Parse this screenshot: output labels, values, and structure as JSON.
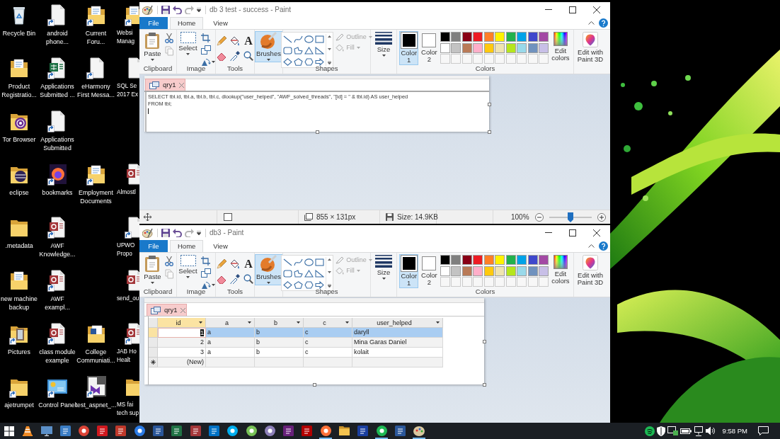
{
  "desktop_rows": [
    {
      "icons": [
        {
          "kind": "recycle-bin",
          "shortcut": false,
          "covered": false,
          "label": "Recycle Bin"
        },
        {
          "kind": "document",
          "shortcut": true,
          "covered": false,
          "label": "android\nphone..."
        },
        {
          "kind": "folder-docs",
          "shortcut": true,
          "covered": false,
          "label": "Current\nForu..."
        },
        {
          "kind": "folder-docs",
          "shortcut": true,
          "covered": true,
          "label": "Websi\nManag"
        }
      ]
    },
    {
      "icons": [
        {
          "kind": "folder-docs",
          "shortcut": false,
          "covered": false,
          "label": "Product\nRegistratio..."
        },
        {
          "kind": "spreadsheet",
          "shortcut": true,
          "covered": false,
          "label": "Applications\nSubmitted ..."
        },
        {
          "kind": "document",
          "shortcut": true,
          "covered": false,
          "label": "eHarmony\nFirst Messa..."
        },
        {
          "kind": "document",
          "shortcut": false,
          "covered": true,
          "label": "SQL Se\n2017 Ex"
        }
      ]
    },
    {
      "icons": [
        {
          "kind": "tor",
          "shortcut": false,
          "covered": false,
          "label": "Tor Browser"
        },
        {
          "kind": "document",
          "shortcut": true,
          "covered": false,
          "label": "Applications\nSubmitted"
        }
      ]
    },
    {
      "icons": [
        {
          "kind": "eclipse",
          "shortcut": false,
          "covered": false,
          "label": "eclipse"
        },
        {
          "kind": "browser",
          "shortcut": true,
          "covered": false,
          "label": "bookmarks"
        },
        {
          "kind": "folder-docs",
          "shortcut": true,
          "covered": false,
          "label": "Employment\nDocuments"
        },
        {
          "kind": "database",
          "shortcut": false,
          "covered": true,
          "label": "Almostl"
        }
      ]
    },
    {
      "icons": [
        {
          "kind": "folder",
          "shortcut": false,
          "covered": false,
          "label": ".metadata"
        },
        {
          "kind": "database",
          "shortcut": true,
          "covered": false,
          "label": "AWF\nKnowledge..."
        },
        {
          "kind": "document",
          "shortcut": true,
          "covered": true,
          "label": "UPWO\nPropo"
        }
      ]
    },
    {
      "icons": [
        {
          "kind": "folder-docs",
          "shortcut": false,
          "covered": false,
          "label": "new machine\nbackup"
        },
        {
          "kind": "database",
          "shortcut": true,
          "covered": false,
          "label": "AWF\nexampl..."
        },
        {
          "kind": "database",
          "shortcut": false,
          "covered": true,
          "label": "send_ou"
        }
      ]
    },
    {
      "icons": [
        {
          "kind": "pictures",
          "shortcut": true,
          "covered": false,
          "label": "Pictures"
        },
        {
          "kind": "database",
          "shortcut": true,
          "covered": false,
          "label": "class module\nexample"
        },
        {
          "kind": "word-folder",
          "shortcut": false,
          "covered": false,
          "label": "College\nCommuniati..."
        },
        {
          "kind": "database",
          "shortcut": true,
          "covered": true,
          "label": "JAB Ho\nHealt"
        }
      ]
    },
    {
      "icons": [
        {
          "kind": "folder",
          "shortcut": true,
          "covered": false,
          "label": "ajetrumpet"
        },
        {
          "kind": "control-panel",
          "shortcut": true,
          "covered": false,
          "label": "Control Panel"
        },
        {
          "kind": "ide",
          "shortcut": true,
          "covered": false,
          "label": "test_aspnet_..."
        },
        {
          "kind": "folder",
          "shortcut": false,
          "covered": true,
          "label": "MS fai\ntech sup"
        }
      ]
    }
  ],
  "windows": [
    {
      "title": "db 3 test - success - Paint",
      "tabs": [
        {
          "label": "File",
          "kind": "file",
          "selected": false
        },
        {
          "label": "Home",
          "kind": "tab",
          "selected": true
        },
        {
          "label": "View",
          "kind": "tab",
          "selected": false
        }
      ],
      "ribbon": {
        "clipboard": {
          "label": "Clipboard",
          "paste": "Paste"
        },
        "image": {
          "label": "Image",
          "select": "Select"
        },
        "tools": {
          "label": "Tools",
          "text_tool": "A"
        },
        "brushes": {
          "label": "Brushes",
          "selected": true
        },
        "shapes": {
          "label": "Shapes",
          "outline": {
            "label": "Outline",
            "disabled": true
          },
          "fill": {
            "label": "Fill",
            "disabled": true
          }
        },
        "size": {
          "label": "Size"
        },
        "colors": {
          "label": "Colors",
          "slots": [
            {
              "label": "Color\n1",
              "selected": true,
              "color": "#000000"
            },
            {
              "label": "Color\n2",
              "selected": false,
              "color": "#ffffff"
            }
          ],
          "palette": [
            {
              "kind": "swatch",
              "color": "#000000"
            },
            {
              "kind": "swatch",
              "color": "#7f7f7f"
            },
            {
              "kind": "swatch",
              "color": "#880015"
            },
            {
              "kind": "swatch",
              "color": "#ed1c24"
            },
            {
              "kind": "swatch",
              "color": "#ff7f27"
            },
            {
              "kind": "swatch",
              "color": "#fff200"
            },
            {
              "kind": "swatch",
              "color": "#22b14c"
            },
            {
              "kind": "swatch",
              "color": "#00a2e8"
            },
            {
              "kind": "swatch",
              "color": "#3f48cc"
            },
            {
              "kind": "swatch",
              "color": "#a349a4"
            },
            {
              "kind": "swatch",
              "color": "#ffffff"
            },
            {
              "kind": "swatch",
              "color": "#c3c3c3"
            },
            {
              "kind": "swatch",
              "color": "#b97a57"
            },
            {
              "kind": "swatch",
              "color": "#ffaec9"
            },
            {
              "kind": "swatch",
              "color": "#ffc90e"
            },
            {
              "kind": "swatch",
              "color": "#efe4b0"
            },
            {
              "kind": "swatch",
              "color": "#b5e61d"
            },
            {
              "kind": "swatch",
              "color": "#99d9ea"
            },
            {
              "kind": "swatch",
              "color": "#7092be"
            },
            {
              "kind": "swatch",
              "color": "#c8bfe7"
            },
            {
              "kind": "empty"
            },
            {
              "kind": "empty"
            },
            {
              "kind": "empty"
            },
            {
              "kind": "empty"
            },
            {
              "kind": "empty"
            },
            {
              "kind": "empty"
            },
            {
              "kind": "empty"
            },
            {
              "kind": "empty"
            },
            {
              "kind": "empty"
            },
            {
              "kind": "empty"
            }
          ],
          "edit": "Edit\ncolors"
        },
        "paint3d": {
          "label": "Edit with\nPaint 3D"
        }
      },
      "canvas": {
        "kind": "query-sql",
        "tab": "qry1",
        "sql": "SELECT tbl.id, tbl.a, tbl.b, tbl.c, dlookup(\"user_helped\", \"AWF_solved_threads\", \"[id] = \" & tbl.id) AS user_helped\nFROM tbl;"
      },
      "status_bar": {
        "dimensions": "855 × 131px",
        "file_size": "Size: 14.9KB",
        "zoom": "100%",
        "zoom_slider": {
          "level": 0.5
        }
      }
    },
    {
      "title": "db3 - Paint",
      "tabs": [
        {
          "label": "File",
          "kind": "file",
          "selected": false
        },
        {
          "label": "Home",
          "kind": "tab",
          "selected": true
        },
        {
          "label": "View",
          "kind": "tab",
          "selected": false
        }
      ],
      "ribbon": {
        "clipboard": {
          "label": "Clipboard",
          "paste": "Paste"
        },
        "image": {
          "label": "Image",
          "select": "Select"
        },
        "tools": {
          "label": "Tools",
          "text_tool": "A"
        },
        "brushes": {
          "label": "Brushes",
          "selected": true
        },
        "shapes": {
          "label": "Shapes",
          "outline": {
            "label": "Outline",
            "disabled": true
          },
          "fill": {
            "label": "Fill",
            "disabled": true
          }
        },
        "size": {
          "label": "Size"
        },
        "colors": {
          "label": "Colors",
          "slots": [
            {
              "label": "Color\n1",
              "selected": true,
              "color": "#000000"
            },
            {
              "label": "Color\n2",
              "selected": false,
              "color": "#ffffff"
            }
          ],
          "palette": [
            {
              "kind": "swatch",
              "color": "#000000"
            },
            {
              "kind": "swatch",
              "color": "#7f7f7f"
            },
            {
              "kind": "swatch",
              "color": "#880015"
            },
            {
              "kind": "swatch",
              "color": "#ed1c24"
            },
            {
              "kind": "swatch",
              "color": "#ff7f27"
            },
            {
              "kind": "swatch",
              "color": "#fff200"
            },
            {
              "kind": "swatch",
              "color": "#22b14c"
            },
            {
              "kind": "swatch",
              "color": "#00a2e8"
            },
            {
              "kind": "swatch",
              "color": "#3f48cc"
            },
            {
              "kind": "swatch",
              "color": "#a349a4"
            },
            {
              "kind": "swatch",
              "color": "#ffffff"
            },
            {
              "kind": "swatch",
              "color": "#c3c3c3"
            },
            {
              "kind": "swatch",
              "color": "#b97a57"
            },
            {
              "kind": "swatch",
              "color": "#ffaec9"
            },
            {
              "kind": "swatch",
              "color": "#ffc90e"
            },
            {
              "kind": "swatch",
              "color": "#efe4b0"
            },
            {
              "kind": "swatch",
              "color": "#b5e61d"
            },
            {
              "kind": "swatch",
              "color": "#99d9ea"
            },
            {
              "kind": "swatch",
              "color": "#7092be"
            },
            {
              "kind": "swatch",
              "color": "#c8bfe7"
            },
            {
              "kind": "empty"
            },
            {
              "kind": "empty"
            },
            {
              "kind": "empty"
            },
            {
              "kind": "empty"
            },
            {
              "kind": "empty"
            },
            {
              "kind": "empty"
            },
            {
              "kind": "empty"
            },
            {
              "kind": "empty"
            },
            {
              "kind": "empty"
            },
            {
              "kind": "empty"
            }
          ],
          "edit": "Edit\ncolors"
        },
        "paint3d": {
          "label": "Edit with\nPaint 3D"
        }
      },
      "canvas": {
        "kind": "datasheet",
        "tab": "qry1",
        "columns": [
          {
            "label": "id",
            "selected": true
          },
          {
            "label": "a",
            "selected": false
          },
          {
            "label": "b",
            "selected": false
          },
          {
            "label": "c",
            "selected": false
          },
          {
            "label": "user_helped",
            "selected": false
          }
        ],
        "rows": [
          {
            "kind": "record",
            "selected": true,
            "current": true,
            "cells": [
              "1",
              "a",
              "b",
              "c",
              "daryll"
            ]
          },
          {
            "kind": "record",
            "selected": false,
            "current": false,
            "cells": [
              "2",
              "a",
              "b",
              "c",
              "Mina Garas Daniel"
            ]
          },
          {
            "kind": "record",
            "selected": false,
            "current": false,
            "cells": [
              "3",
              "a",
              "b",
              "c",
              "kolait"
            ]
          },
          {
            "kind": "new",
            "selected": false,
            "current": false,
            "cells": [
              "(New)"
            ]
          }
        ]
      }
    }
  ],
  "taskbar": {
    "apps": [
      {
        "kind": "start",
        "open": false
      },
      {
        "kind": "cone",
        "color": "#f08a24",
        "open": false
      },
      {
        "kind": "monitor",
        "color": "#5b8fc7",
        "open": false
      },
      {
        "kind": "tile",
        "color": "#3b7dc4",
        "open": false
      },
      {
        "kind": "circle",
        "color": "#db4437",
        "open": false
      },
      {
        "kind": "tile",
        "color": "#d0191f",
        "open": false
      },
      {
        "kind": "tile",
        "color": "#c0392b",
        "open": false
      },
      {
        "kind": "circle",
        "color": "#2c7be5",
        "open": false
      },
      {
        "kind": "tile",
        "color": "#2b579a",
        "open": false
      },
      {
        "kind": "tile",
        "color": "#217346",
        "open": false
      },
      {
        "kind": "tile",
        "color": "#a4373a",
        "open": false
      },
      {
        "kind": "tile",
        "color": "#0072c6",
        "open": false
      },
      {
        "kind": "circle",
        "color": "#00aff0",
        "open": false
      },
      {
        "kind": "circle",
        "color": "#78c257",
        "open": false
      },
      {
        "kind": "circle",
        "color": "#8c7fb8",
        "open": false
      },
      {
        "kind": "tile",
        "color": "#68217a",
        "open": false
      },
      {
        "kind": "tile",
        "color": "#b20000",
        "open": false
      },
      {
        "kind": "circle",
        "color": "#ff7139",
        "open": true
      },
      {
        "kind": "folder",
        "color": "#f3c24f",
        "open": false
      },
      {
        "kind": "tile",
        "color": "#1b3fa0",
        "open": false
      },
      {
        "kind": "circle",
        "color": "#1db954",
        "open": true
      },
      {
        "kind": "tile",
        "color": "#2b579a",
        "open": false
      },
      {
        "kind": "palette",
        "color": "#d9c8a0",
        "open": true
      }
    ],
    "tray": [
      {
        "kind": "music"
      },
      {
        "kind": "shield"
      },
      {
        "kind": "device"
      },
      {
        "kind": "battery"
      },
      {
        "kind": "network"
      },
      {
        "kind": "volume"
      }
    ],
    "clock": "9:58 PM"
  }
}
